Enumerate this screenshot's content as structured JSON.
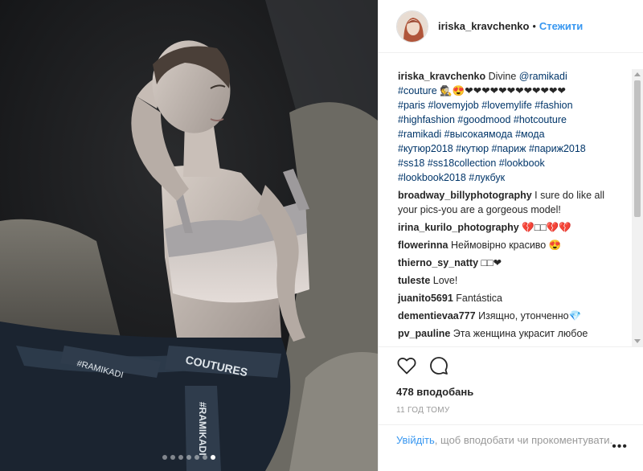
{
  "header": {
    "username": "iriska_kravchenko",
    "separator": "•",
    "follow_label": "Стежити"
  },
  "caption": {
    "username": "iriska_kravchenko",
    "text_before": " Divine ",
    "mention": "@ramikadi",
    "line2_tag": "#couture",
    "line2_emoji": " 🕵😍❤❤❤❤❤❤❤❤❤❤❤❤",
    "hashtags": [
      "#paris",
      "#lovemyjob",
      "#lovemylife",
      "#fashion",
      "#highfashion",
      "#goodmood",
      "#hotcouture",
      "#ramikadi",
      "#высокаямода",
      "#мода",
      "#кутюр2018",
      "#кутюр",
      "#париж",
      "#париж2018",
      "#ss18",
      "#ss18collection",
      "#lookbook",
      "#lookbook2018",
      "#лукбук"
    ]
  },
  "comments": [
    {
      "user": "broadway_billyphotography",
      "text": " I sure do like all your pics-you are a gorgeous model!"
    },
    {
      "user": "irina_kurilo_photography",
      "text": " 💔□□💔💔"
    },
    {
      "user": "flowerinna",
      "text": " Неймовірно красиво 😍"
    },
    {
      "user": "thierno_sy_natty",
      "text": " □□❤"
    },
    {
      "user": "tuleste",
      "text": " Love!"
    },
    {
      "user": "juanito5691",
      "text": " Fantástica"
    },
    {
      "user": "dementievaa777",
      "text": " Изящно, утонченно💎"
    },
    {
      "user": "pv_pauline",
      "text": " Эта женщина украсит любое"
    }
  ],
  "actions": {
    "likes": "478 вподобань",
    "time": "11 ГОД ТОМУ"
  },
  "login": {
    "link": "Увійдіть",
    "text": ", щоб вподобати чи прокоментувати.",
    "more": "•••"
  },
  "carousel": {
    "count": 7,
    "active_index": 6
  },
  "colors": {
    "link": "#3897f0",
    "hashtag": "#003569",
    "muted": "#999999"
  }
}
